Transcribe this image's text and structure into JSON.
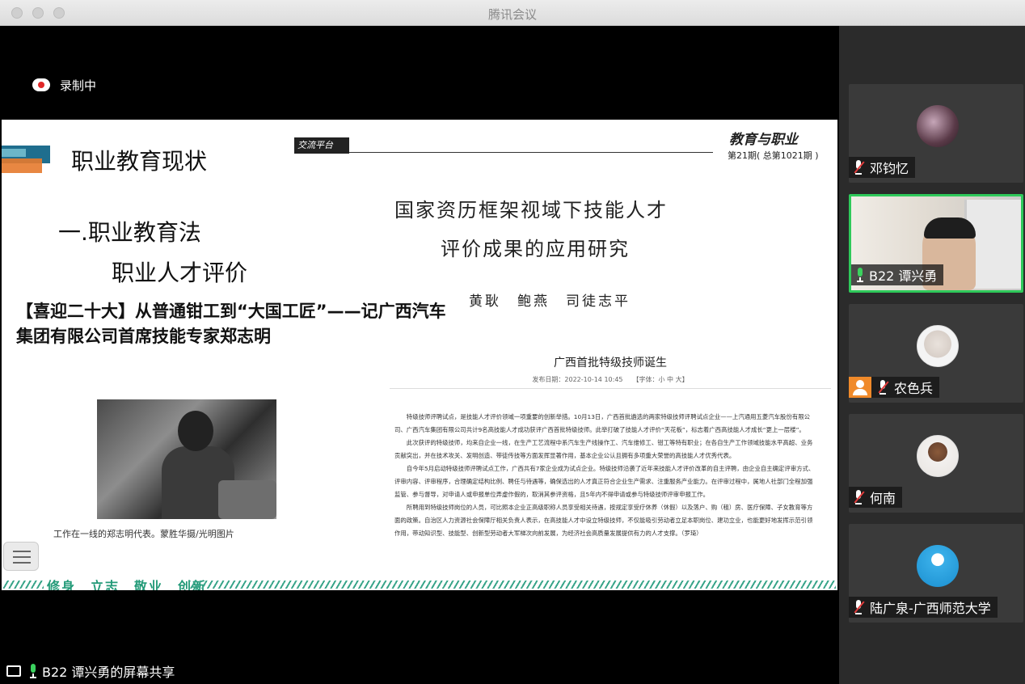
{
  "window": {
    "title": "腾讯会议"
  },
  "recording": {
    "label": "录制中"
  },
  "slide": {
    "heading": "职业教育现状",
    "sub1": "一.职业教育法",
    "sub2": "职业人才评价",
    "news_title": "【喜迎二十大】从普通钳工到“大国工匠”——记广西汽车集团有限公司首席技能专家郑志明",
    "photo_caption": "工作在一线的郑志明代表。蒙胜华摄/光明图片",
    "journal_tag": "交流平台",
    "journal_name": "教育与职业",
    "journal_issue": "第21期( 总第1021期 )",
    "article_title_line1": "国家资历框架视域下技能人才",
    "article_title_line2": "评价成果的应用研究",
    "authors": "黄耿　鲍燕　司徒志平",
    "notice": {
      "title": "广西首批特级技师诞生",
      "meta": "发布日期：2022-10-14 10:45　　【字体：小 中 大】",
      "paragraphs": [
        "特级技师评聘试点，是技能人才评价领域一项重要的创新举措。10月13日，广西首批遴选的两家特级技师评聘试点企业——上汽通用五菱汽车股份有限公司、广西汽车集团有限公司共计9名高技能人才成功获评广西首批特级技师。此举打破了技能人才评价“天花板”，标志着广西高技能人才成长“更上一层楼”。",
        "此次获评的特级技师，均来自企业一线，在生产工艺流程中系汽车生产线操作工、汽车维修工、钳工等特有职业；在各自生产工作领域技能水平高超、业务贡献突出，并在技术攻关、发明创造、带徒传技等方面发挥显著作用，基本企业公认且拥有多项重大荣誉的高技能人才优秀代表。",
        "自今年5月启动特级技师评聘试点工作，广西共有7家企业成为试点企业。特级技师沿袭了近年来技能人才评价改革的自主评聘，由企业自主确定评审方式、评审内容、评审程序，合理确定结构比例、聘任与待遇等，确保选出的人才真正符合企业生产需求、注重服务产业能力。在评审过程中，属地人社部门全程加强监管、参与督导，对申请人或申报单位弄虚作假的，取消其参评资格，且5年内不得申请或参与特级技师评审申报工作。",
        "所聘用到特级技师岗位的人员，可比照本企业正高级职称人员享受相关待遇，按规定享受疗休养（休假）以及落户、购（租）房、医疗保障、子女教育等方面的政策。自治区人力资源社会保障厅相关负责人表示，在高技能人才中设立特级技师，不仅能吸引劳动者立足本职岗位、建功立业，也能更好地发挥示范引领作用，带动知识型、技能型、创新型劳动者大军梯次向前发展，为经济社会高质量发展提供有力的人才支撑。（罗琦）"
      ]
    },
    "motto": "修身　立志　敬业　创新"
  },
  "footer": {
    "share_label": "B22 谭兴勇的屏幕共享"
  },
  "participants": [
    {
      "name": "邓钧忆"
    },
    {
      "name": "B22 谭兴勇"
    },
    {
      "name": "农色兵"
    },
    {
      "name": "何南"
    },
    {
      "name": "陆广泉-广西师范大学"
    }
  ],
  "colors": {
    "active_speaker": "#2ec95a",
    "motto": "#239a78",
    "mute": "#e23b3b"
  }
}
